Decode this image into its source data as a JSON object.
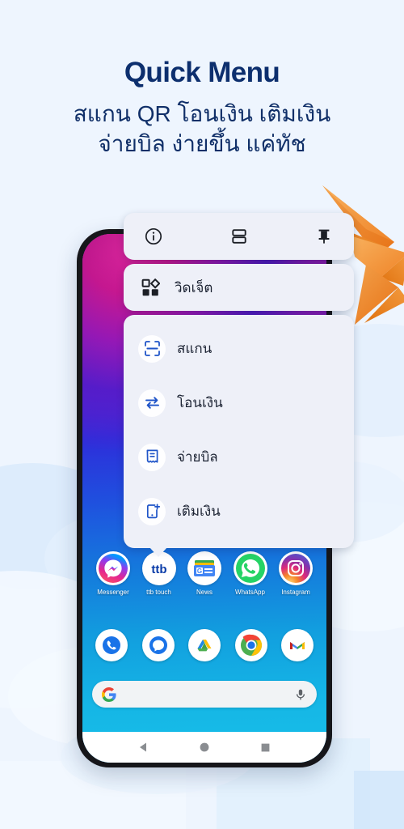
{
  "header": {
    "title": "Quick Menu",
    "subtitle_line1": "สแกน QR โอนเงิน เติมเงิน",
    "subtitle_line2": "จ่ายบิล ง่ายขึ้น แค่ทัช",
    "title_color": "#0d2f6e",
    "subtitle_color": "#102f68"
  },
  "background": {
    "color": "#eef5fe",
    "cloud_color": "#d8eafb",
    "accent_orange": "#ef8327"
  },
  "popup": {
    "toolbar": {
      "icons": [
        {
          "name": "info-icon",
          "label": "ข้อมูลแอป"
        },
        {
          "name": "split-screen-icon",
          "label": "แบ่งหน้าจอ"
        },
        {
          "name": "pin-icon",
          "label": "ปักหมุด"
        }
      ]
    },
    "widget_row": {
      "icon": "widgets-icon",
      "label": "วิดเจ็ต"
    },
    "menu_items": [
      {
        "icon": "scan-qr-icon",
        "label": "สแกน"
      },
      {
        "icon": "transfer-icon",
        "label": "โอนเงิน"
      },
      {
        "icon": "bill-icon",
        "label": "จ่ายบิล"
      },
      {
        "icon": "topup-icon",
        "label": "เติมเงิน"
      }
    ],
    "accent_color": "#1f54c8",
    "panel_color": "#eef0f8"
  },
  "phone": {
    "wallpaper_colors": [
      "#d11fa8",
      "#5a22d8",
      "#1f51e0",
      "#18bfe8"
    ],
    "apps": [
      {
        "name": "messenger",
        "label": "Messenger"
      },
      {
        "name": "ttb-touch",
        "label": "ttb touch"
      },
      {
        "name": "news",
        "label": "News"
      },
      {
        "name": "whatsapp",
        "label": "WhatsApp"
      },
      {
        "name": "instagram",
        "label": "Instagram"
      }
    ],
    "dock": [
      {
        "name": "phone",
        "label": "Phone"
      },
      {
        "name": "messages",
        "label": "Messages"
      },
      {
        "name": "drive",
        "label": "Drive"
      },
      {
        "name": "chrome",
        "label": "Chrome"
      },
      {
        "name": "gmail",
        "label": "Gmail"
      }
    ],
    "search": {
      "logo": "google-g-icon",
      "mic": "microphone-icon",
      "placeholder": ""
    },
    "navbar": [
      {
        "name": "back-button",
        "label": "Back"
      },
      {
        "name": "home-button",
        "label": "Home"
      },
      {
        "name": "recents-button",
        "label": "Recents"
      }
    ]
  }
}
